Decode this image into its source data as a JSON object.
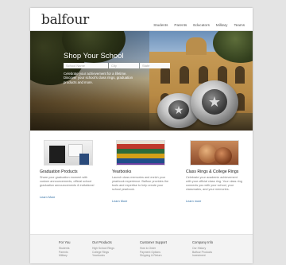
{
  "header": {
    "logo": "balfour",
    "nav": [
      "Students",
      "Parents",
      "Educators",
      "Military",
      "Teams"
    ]
  },
  "hero": {
    "title": "Shop Your School",
    "search": {
      "school_placeholder": "School Name",
      "city_placeholder": "City",
      "state_placeholder": "State"
    },
    "description": "Celebrate your achievement for a lifetime. Discover your school's class rings, graduation products and more."
  },
  "products": [
    {
      "title": "Graduation Products",
      "text": "Share your graduation moment with custom announcements, official school graduation announcements & invitations!",
      "more": "Learn More"
    },
    {
      "title": "Yearbooks",
      "text": "Launch class memories and enrich your yearbook experience. Balfour provides the tools and expertise to help create your school yearbook.",
      "more": "Learn More"
    },
    {
      "title": "Class Rings & College Rings",
      "text": "Celebrate your academic achievement with your official class ring. Your class ring connects you with your school, your classmates, and your memories.",
      "more": "Learn more"
    }
  ],
  "footer": {
    "columns": [
      {
        "heading": "For You",
        "links": [
          "Students",
          "Parents",
          "Military"
        ]
      },
      {
        "heading": "Our Products",
        "links": [
          "High School Rings",
          "College Rings",
          "Yearbooks"
        ]
      },
      {
        "heading": "Customer Support",
        "links": [
          "How to Order",
          "Payment Options",
          "Shipping & Return"
        ]
      },
      {
        "heading": "Company Info",
        "links": [
          "Our History",
          "Balfour Products",
          "Investment"
        ]
      }
    ]
  }
}
